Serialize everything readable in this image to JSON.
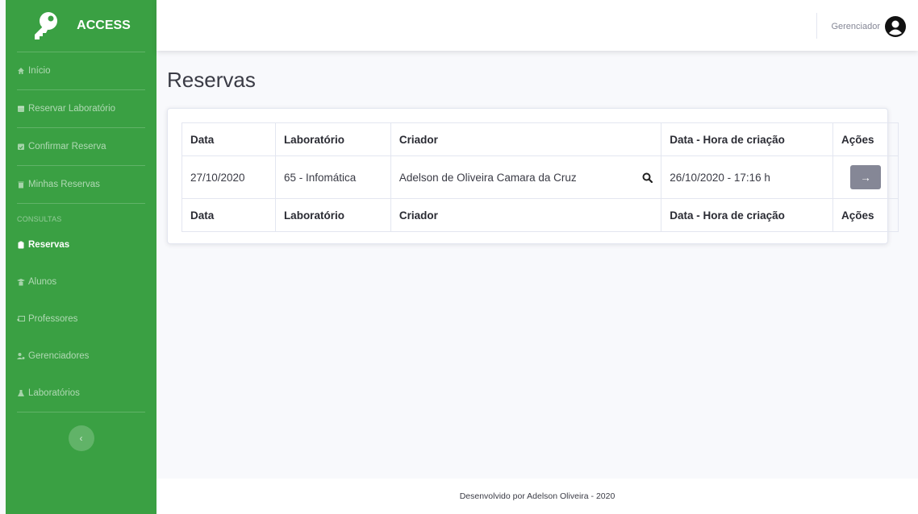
{
  "brand": {
    "name": "ACCESS",
    "icon": "key-icon"
  },
  "sidebar": {
    "items_top": [
      {
        "label": "Início",
        "icon": "home-icon"
      },
      {
        "label": "Reservar Laboratório",
        "icon": "calendar-plus-icon"
      },
      {
        "label": "Confirmar Reserva",
        "icon": "calendar-check-icon"
      },
      {
        "label": "Minhas Reservas",
        "icon": "trash-icon"
      }
    ],
    "heading": "CONSULTAS",
    "items_bottom": [
      {
        "label": "Reservas",
        "icon": "clipboard-icon",
        "active": true
      },
      {
        "label": "Alunos",
        "icon": "graduate-icon"
      },
      {
        "label": "Professores",
        "icon": "chalkboard-icon"
      },
      {
        "label": "Gerenciadores",
        "icon": "users-cog-icon"
      },
      {
        "label": "Laboratórios",
        "icon": "flask-icon"
      }
    ],
    "toggle_glyph": "‹"
  },
  "topbar": {
    "user_label": "Gerenciador",
    "user_icon": "user-circle-icon"
  },
  "main": {
    "title": "Reservas",
    "table": {
      "headers": [
        "Data",
        "Laboratório",
        "Criador",
        "Data - Hora de criação",
        "Ações"
      ],
      "rows": [
        {
          "data": "27/10/2020",
          "laboratorio": "65 - Infomática",
          "criador": "Adelson de Oliveira Camara da Cruz",
          "criacao": "26/10/2020 - 17:16 h",
          "action_glyph": "→"
        }
      ],
      "footer": [
        "Data",
        "Laboratório",
        "Criador",
        "Data - Hora de criação",
        "Ações"
      ]
    }
  },
  "footer": {
    "text": "Desenvolvido por Adelson Oliveira - 2020"
  },
  "colors": {
    "sidebar": "#3aa043",
    "background": "#f8f9fc",
    "button": "#858796"
  }
}
